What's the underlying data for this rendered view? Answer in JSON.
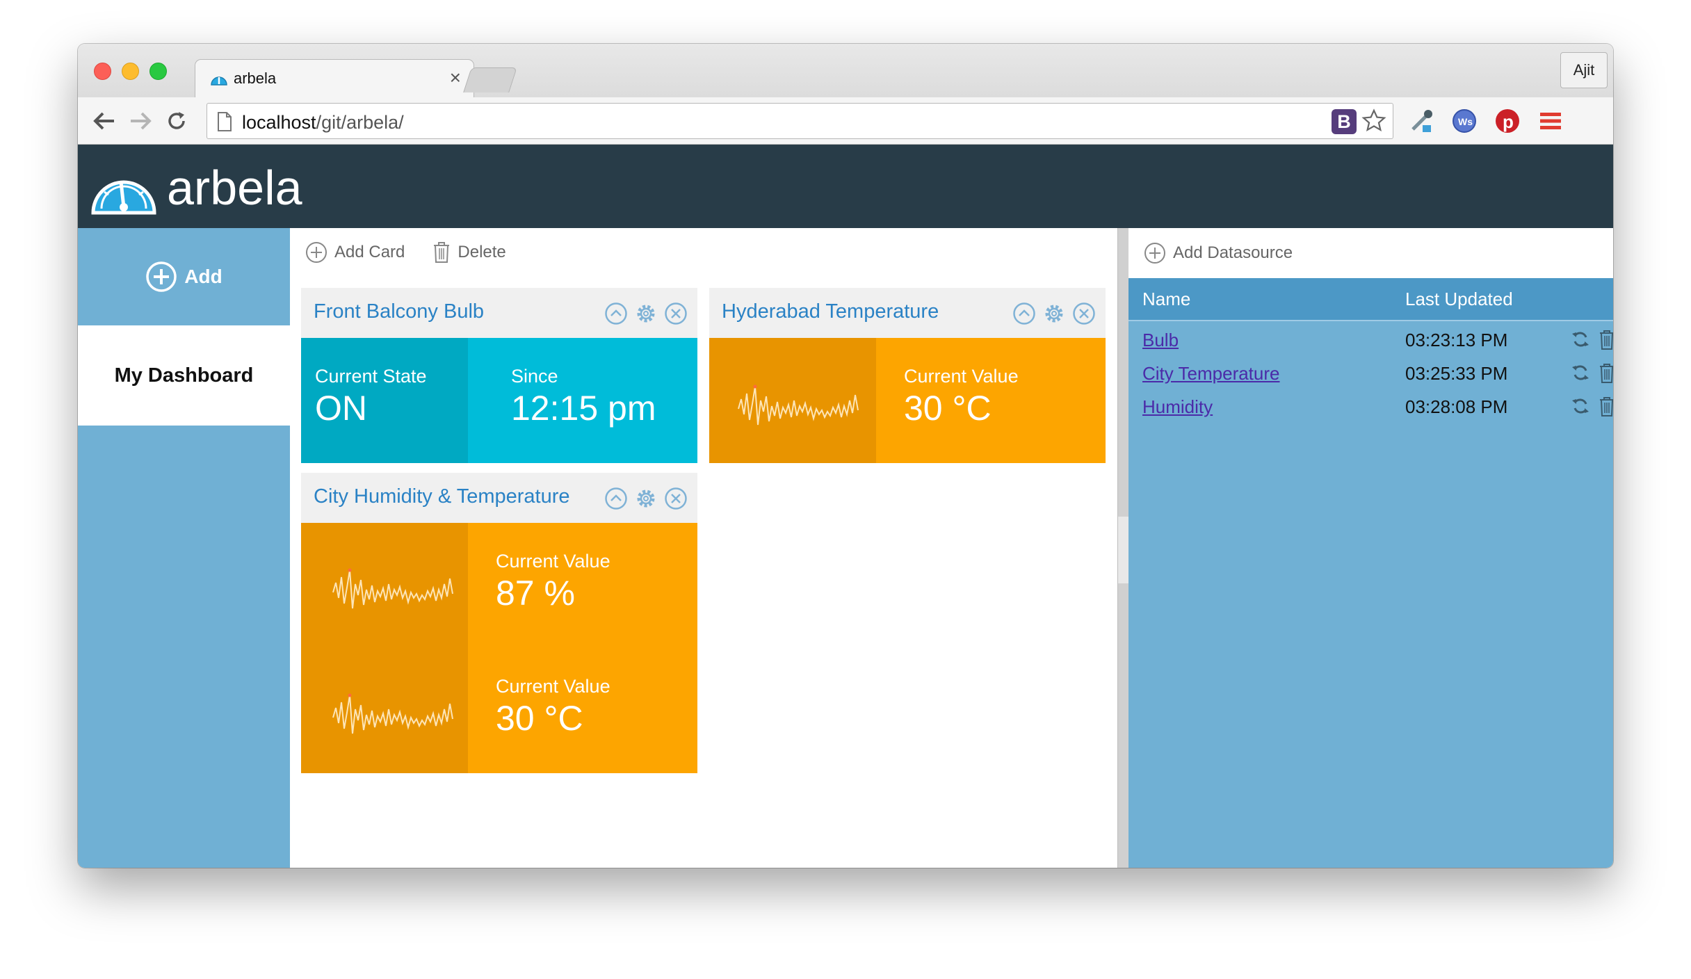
{
  "browser": {
    "tab_title": "arbela",
    "tab_close": "×",
    "profile_name": "Ajit",
    "url_host": "localhost",
    "url_path": "/git/arbela/",
    "bookmark_ext_label": "B"
  },
  "app": {
    "title": "arbela"
  },
  "sidebar": {
    "add_label": "Add",
    "dashboards": [
      "My Dashboard"
    ]
  },
  "toolbar": {
    "add_card": "Add Card",
    "delete": "Delete"
  },
  "cards": {
    "bulb": {
      "title": "Front Balcony Bulb",
      "state_label": "Current State",
      "state_value": "ON",
      "since_label": "Since",
      "since_value": "12:15 pm"
    },
    "hyderabad": {
      "title": "Hyderabad Temperature",
      "value_label": "Current Value",
      "value": "30 °C"
    },
    "city": {
      "title": "City Humidity & Temperature",
      "humidity_label": "Current Value",
      "humidity_value": "87 %",
      "temperature_label": "Current Value",
      "temperature_value": "30 °C"
    }
  },
  "datasources": {
    "add_label": "Add Datasource",
    "col_name": "Name",
    "col_updated": "Last Updated",
    "rows": [
      {
        "name": "Bulb",
        "updated": "03:23:13 PM"
      },
      {
        "name": "City Temperature",
        "updated": "03:25:33 PM"
      },
      {
        "name": "Humidity",
        "updated": "03:28:08 PM"
      }
    ]
  },
  "colors": {
    "header": "#283c48",
    "sidebar": "#70b0d4",
    "accent_blue": "#2a82c5",
    "cyan": "#00bcd9",
    "cyan_dark": "#00a9c2",
    "orange": "#fda500",
    "orange_dark": "#e89400"
  }
}
